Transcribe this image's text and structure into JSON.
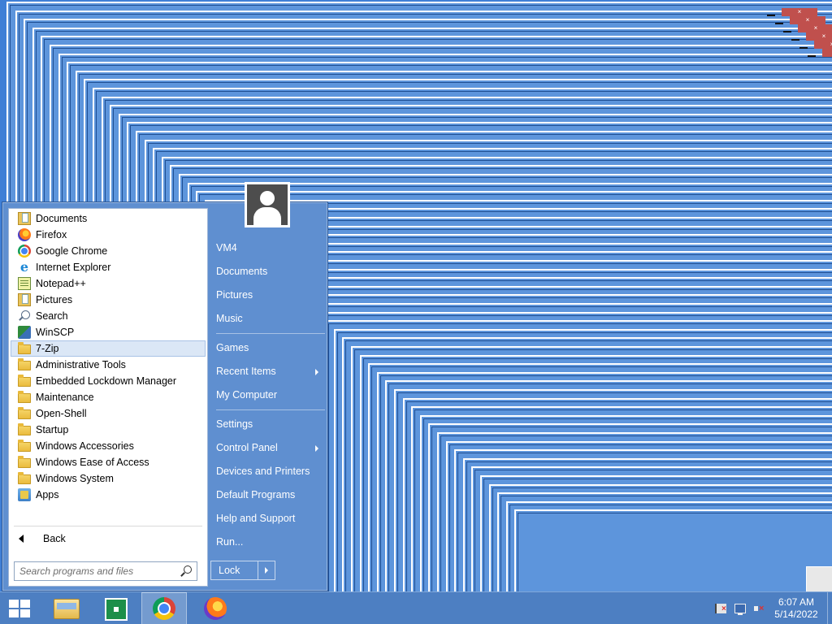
{
  "colors": {
    "desktop": "#3f7fd6",
    "start_menu_bg": "#5f8fd0",
    "taskbar_bg": "#4d7fc2",
    "selected_item": "#dbe7f6",
    "close_button": "#c0504d"
  },
  "start_menu": {
    "programs": [
      {
        "label": "Documents",
        "icon": "documents-folder-icon"
      },
      {
        "label": "Firefox",
        "icon": "firefox-icon"
      },
      {
        "label": "Google Chrome",
        "icon": "chrome-icon"
      },
      {
        "label": "Internet Explorer",
        "icon": "internet-explorer-icon"
      },
      {
        "label": "Notepad++",
        "icon": "notepad-plus-plus-icon"
      },
      {
        "label": "Pictures",
        "icon": "pictures-folder-icon"
      },
      {
        "label": "Search",
        "icon": "search-icon"
      },
      {
        "label": "WinSCP",
        "icon": "winscp-icon"
      },
      {
        "label": "7-Zip",
        "icon": "folder-icon",
        "selected": true
      },
      {
        "label": "Administrative Tools",
        "icon": "folder-icon"
      },
      {
        "label": "Embedded Lockdown Manager",
        "icon": "folder-icon"
      },
      {
        "label": "Maintenance",
        "icon": "folder-icon"
      },
      {
        "label": "Open-Shell",
        "icon": "folder-icon"
      },
      {
        "label": "Startup",
        "icon": "folder-icon"
      },
      {
        "label": "Windows Accessories",
        "icon": "folder-icon"
      },
      {
        "label": "Windows Ease of Access",
        "icon": "folder-icon"
      },
      {
        "label": "Windows System",
        "icon": "folder-icon"
      },
      {
        "label": "Apps",
        "icon": "apps-icon"
      }
    ],
    "back_label": "Back",
    "search_placeholder": "Search programs and files",
    "right_column": {
      "user_name": "VM4",
      "items": [
        {
          "label": "Documents"
        },
        {
          "label": "Pictures"
        },
        {
          "label": "Music"
        },
        {
          "label": "Games"
        },
        {
          "label": "Recent Items",
          "submenu": true
        },
        {
          "label": "My Computer"
        },
        {
          "label": "Settings"
        },
        {
          "label": "Control Panel",
          "submenu": true
        },
        {
          "label": "Devices and Printers"
        },
        {
          "label": "Default Programs"
        },
        {
          "label": "Help and Support"
        },
        {
          "label": "Run..."
        }
      ]
    },
    "lock_label": "Lock"
  },
  "taskbar": {
    "buttons": [
      {
        "name": "file-explorer",
        "icon": "folder-icon"
      },
      {
        "name": "store",
        "icon": "store-icon"
      },
      {
        "name": "google-chrome",
        "icon": "chrome-icon",
        "active": true
      },
      {
        "name": "firefox",
        "icon": "firefox-icon"
      }
    ],
    "tray_icons": [
      "action-center-flag-icon",
      "network-icon",
      "volume-muted-icon"
    ],
    "clock": {
      "time": "6:07 AM",
      "date": "5/14/2022"
    }
  }
}
